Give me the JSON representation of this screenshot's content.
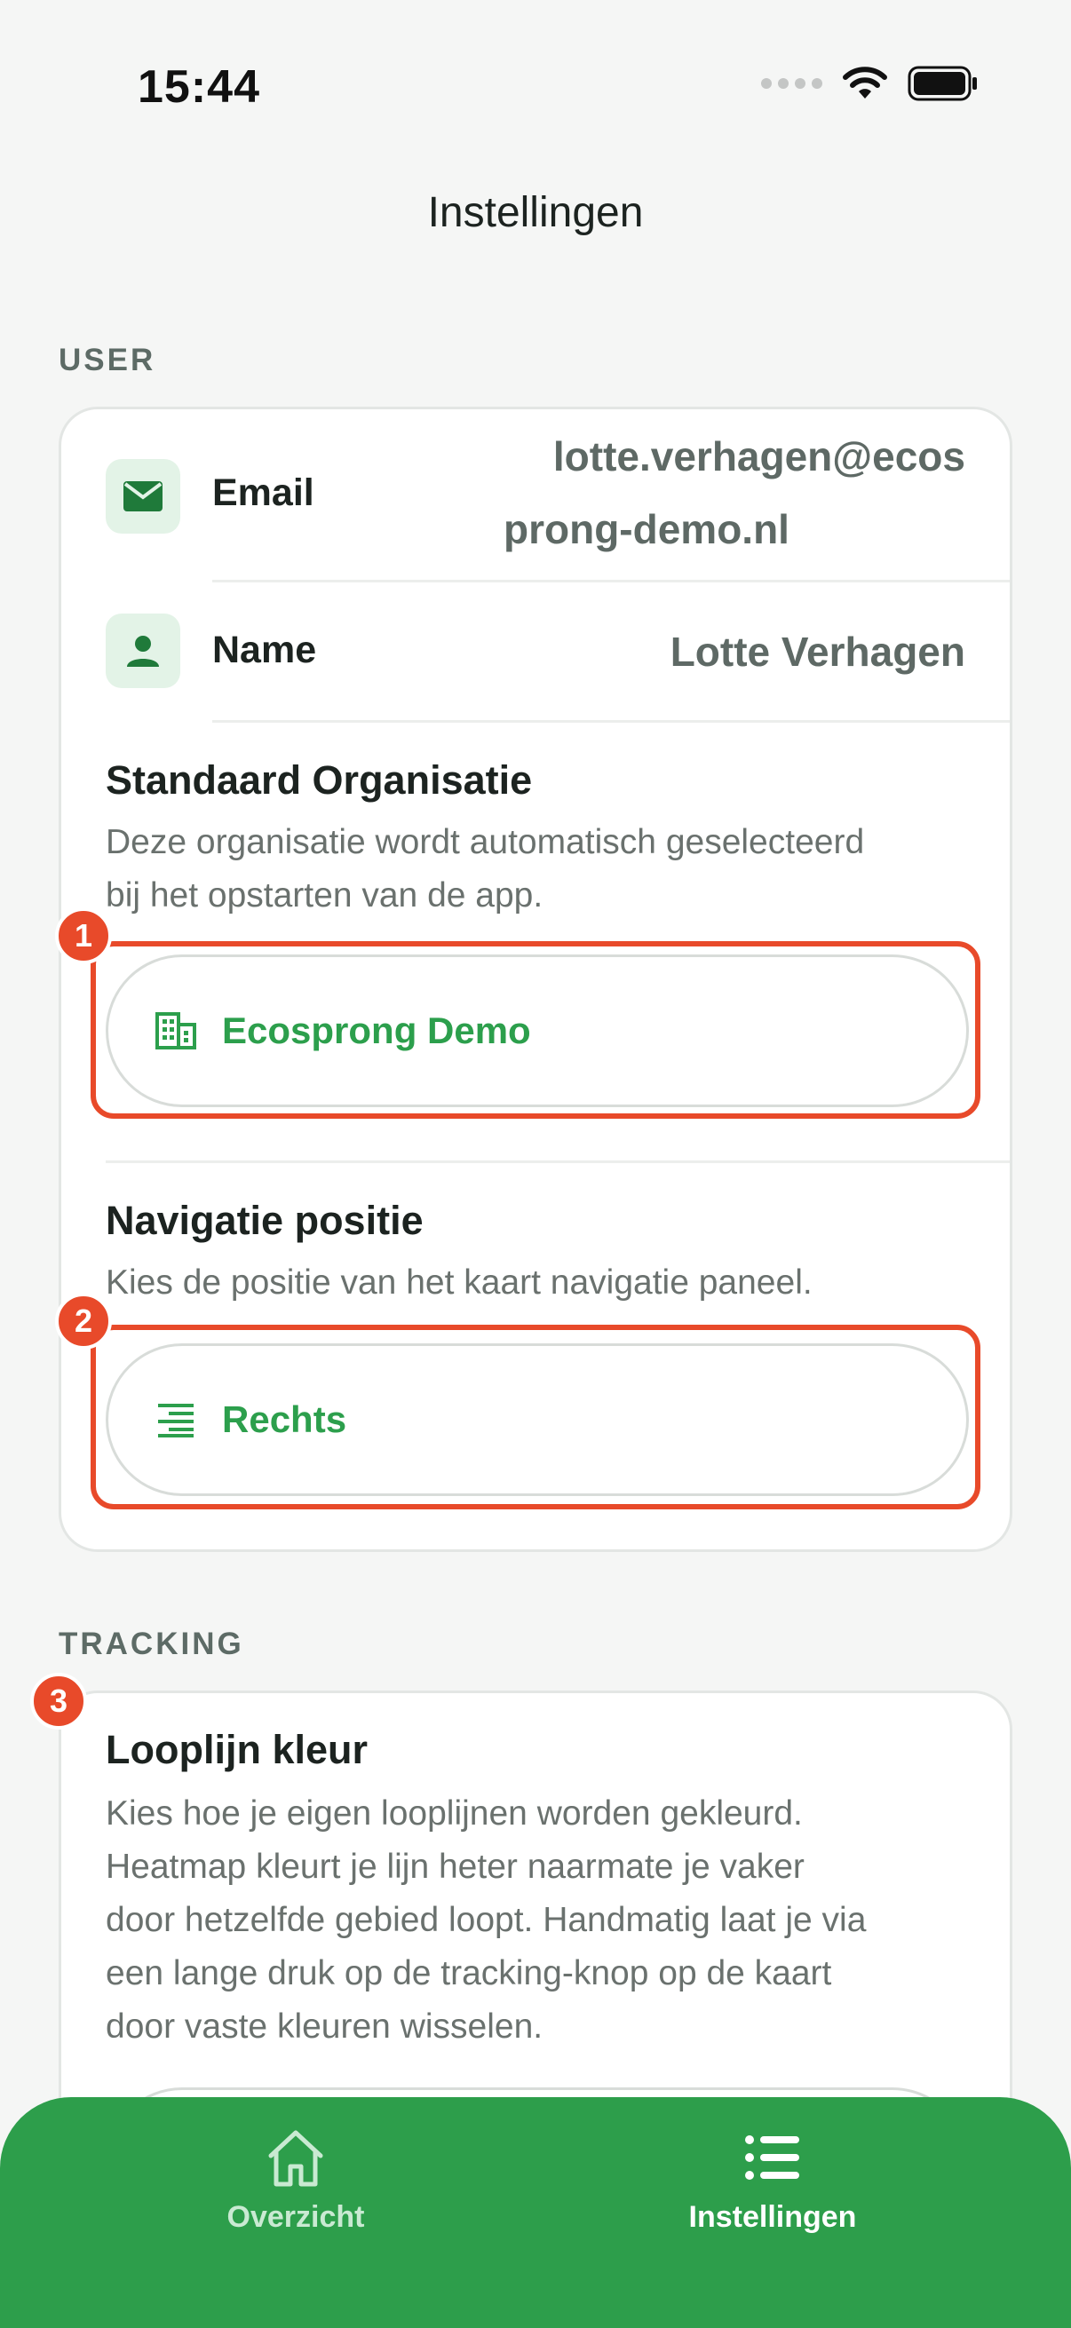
{
  "status_bar": {
    "time": "15:44"
  },
  "header": {
    "title": "Instellingen"
  },
  "sections": {
    "user": {
      "label": "USER",
      "email_label": "Email",
      "email_value_line1": "lotte.verhagen@ecos",
      "email_value_line2": "prong-demo.nl",
      "name_label": "Name",
      "name_value": "Lotte Verhagen",
      "org": {
        "title": "Standaard Organisatie",
        "description_line1": "Deze organisatie wordt automatisch geselecteerd",
        "description_line2": "bij het opstarten van de app.",
        "selected": "Ecosprong Demo"
      },
      "nav_position": {
        "title": "Navigatie positie",
        "description": "Kies de positie van het kaart navigatie paneel.",
        "selected": "Rechts"
      }
    },
    "tracking": {
      "label": "TRACKING",
      "line_color": {
        "title": "Looplijn kleur",
        "description_lines": [
          "Kies hoe je eigen looplijnen worden gekleurd.",
          "Heatmap kleurt je lijn heter naarmate je vaker",
          "door hetzelfde gebied loopt. Handmatig laat je via",
          "een lange druk op de tracking-knop op de kaart",
          "door vaste kleuren wisselen."
        ]
      }
    }
  },
  "annotations": {
    "badge_1": "1",
    "badge_2": "2",
    "badge_3": "3"
  },
  "tab_bar": {
    "tabs": [
      {
        "label": "Overzicht",
        "icon": "home-icon"
      },
      {
        "label": "Instellingen",
        "icon": "list-icon"
      }
    ]
  },
  "colors": {
    "accent": "#2d9e4b",
    "highlight": "#e84a2a"
  }
}
